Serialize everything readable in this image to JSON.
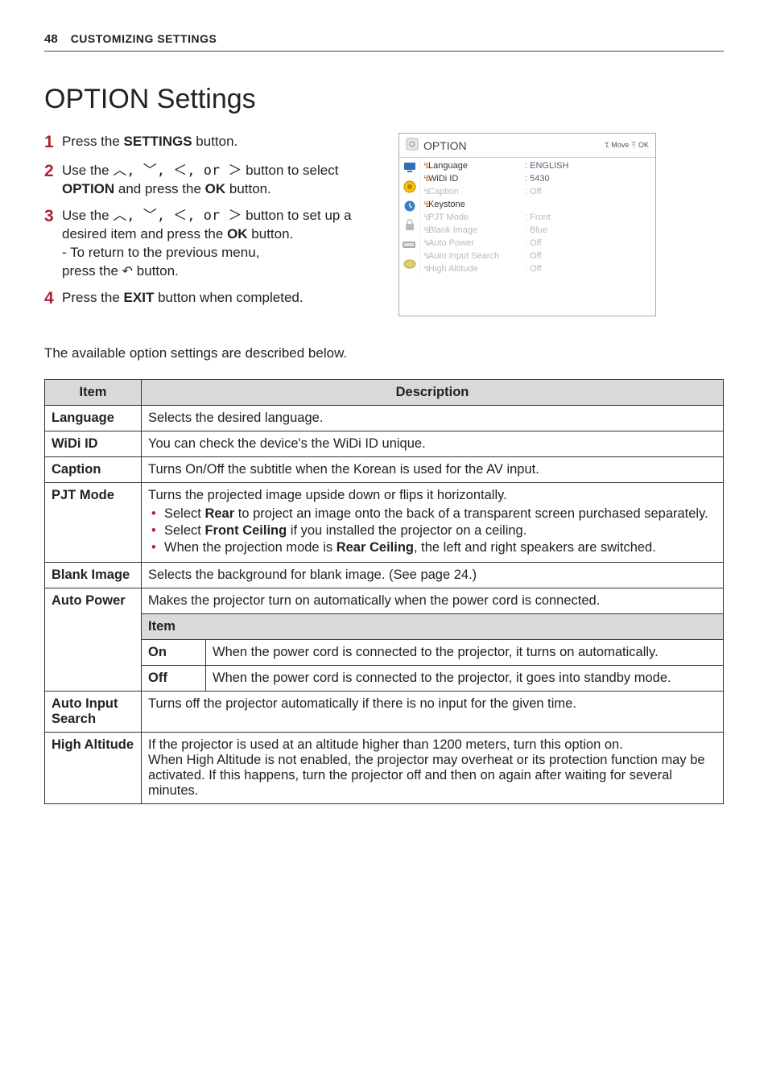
{
  "header": {
    "page": "48",
    "section": "CUSTOMIZING SETTINGS"
  },
  "title": "OPTION Settings",
  "steps": {
    "s1a": "Press the ",
    "s1b": "SETTINGS",
    "s1c": " button.",
    "s2a": "Use the ",
    "s2b": " button to select ",
    "s2c": "OPTION",
    "s2d": " and press the ",
    "s2e": "OK",
    "s2f": " button.",
    "s2arrows": "︿, ﹀, ＜, or ＞",
    "s3a": "Use the ",
    "s3b": " button to set up a desired item and press the ",
    "s3c": "OK",
    "s3d": " button.",
    "s3e": "- To return to the previous menu,",
    "s3f": "press the ",
    "s3g": " button.",
    "s4a": "Press the ",
    "s4b": "EXIT",
    "s4c": " button when completed."
  },
  "osd": {
    "title": "OPTION",
    "move": "ꔂ Move  ꔉ OK",
    "items": [
      {
        "dot": "ꔈ",
        "label": "Language",
        "value": ": ENGLISH",
        "disabled": false
      },
      {
        "dot": "ꔈ",
        "label": "WiDi ID",
        "value": ": 5430",
        "disabled": false
      },
      {
        "dot": "ꔈ",
        "label": "Caption",
        "value": ": Off",
        "disabled": true
      },
      {
        "dot": "ꔈ",
        "label": "Keystone",
        "value": "",
        "disabled": false
      },
      {
        "dot": "ꔈ",
        "label": "PJT Mode",
        "value": ": Front",
        "disabled": true
      },
      {
        "dot": "ꔈ",
        "label": "Blank Image",
        "value": ": Blue",
        "disabled": true
      },
      {
        "dot": "ꔈ",
        "label": "Auto Power",
        "value": ": Off",
        "disabled": true
      },
      {
        "dot": "ꔈ",
        "label": "Auto Input Search",
        "value": ": Off",
        "disabled": true
      },
      {
        "dot": "ꔈ",
        "label": "High Altitude",
        "value": ": Off",
        "disabled": true
      }
    ]
  },
  "intro": "The available option settings are described below.",
  "table": {
    "h_item": "Item",
    "h_desc": "Description",
    "language": {
      "label": "Language",
      "desc": "Selects the desired language."
    },
    "widi": {
      "label": "WiDi ID",
      "desc": "You can check the device's the WiDi ID unique."
    },
    "caption": {
      "label": "Caption",
      "desc": "Turns On/Off the subtitle when the Korean is used for the AV input."
    },
    "pjt": {
      "label": "PJT Mode",
      "lead": "Turns the projected image upside down or flips it horizontally.",
      "b1a": "Select ",
      "b1b": "Rear",
      "b1c": " to project an image onto the back of a transparent screen purchased separately.",
      "b2a": "Select ",
      "b2b": "Front Ceiling",
      "b2c": " if you installed the projector on a ceiling.",
      "b3a": "When the projection mode is ",
      "b3b": "Rear Ceiling",
      "b3c": ", the left and right speakers are switched."
    },
    "blank": {
      "label": "Blank Image",
      "desc": "Selects the background for blank image. (See page 24.)"
    },
    "autopower": {
      "label": "Auto Power",
      "desc": "Makes the projector turn on automatically when the power cord is connected.",
      "item_header": "Item",
      "on_label": "On",
      "on_desc": "When the power cord is connected to the projector, it turns on automatically.",
      "off_label": "Off",
      "off_desc": "When the power cord is connected to the projector, it goes into standby mode."
    },
    "autoinput": {
      "label": "Auto Input Search",
      "desc": "Turns off the projector automatically if there is no input for the given time."
    },
    "highalt": {
      "label": "High Altitude",
      "desc": "If the projector is used at an altitude higher than 1200 meters, turn this option on.\nWhen High Altitude is not enabled, the projector may overheat or its protection function may be activated. If this happens, turn the projector off and then on again after waiting for several minutes."
    }
  }
}
